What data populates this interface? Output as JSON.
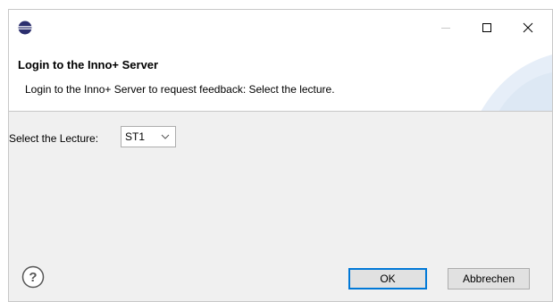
{
  "window": {
    "behind_title_fragment": "…",
    "colors": {
      "accent": "#0078d7",
      "icon_navy": "#2c2f6e",
      "header_art": "#dde8f4"
    }
  },
  "titlebar": {
    "app_icon": "eclipse-icon",
    "minimize_icon": "minimize-icon",
    "maximize_icon": "maximize-icon",
    "close_icon": "close-icon"
  },
  "header": {
    "title": "Login to the Inno+ Server",
    "description": "Login to the Inno+ Server to request feedback: Select the lecture."
  },
  "content": {
    "lecture_label": "Select the Lecture:",
    "lecture_selected": "ST1"
  },
  "footer": {
    "help_icon": "help-icon",
    "ok_label": "OK",
    "cancel_label": "Abbrechen"
  }
}
